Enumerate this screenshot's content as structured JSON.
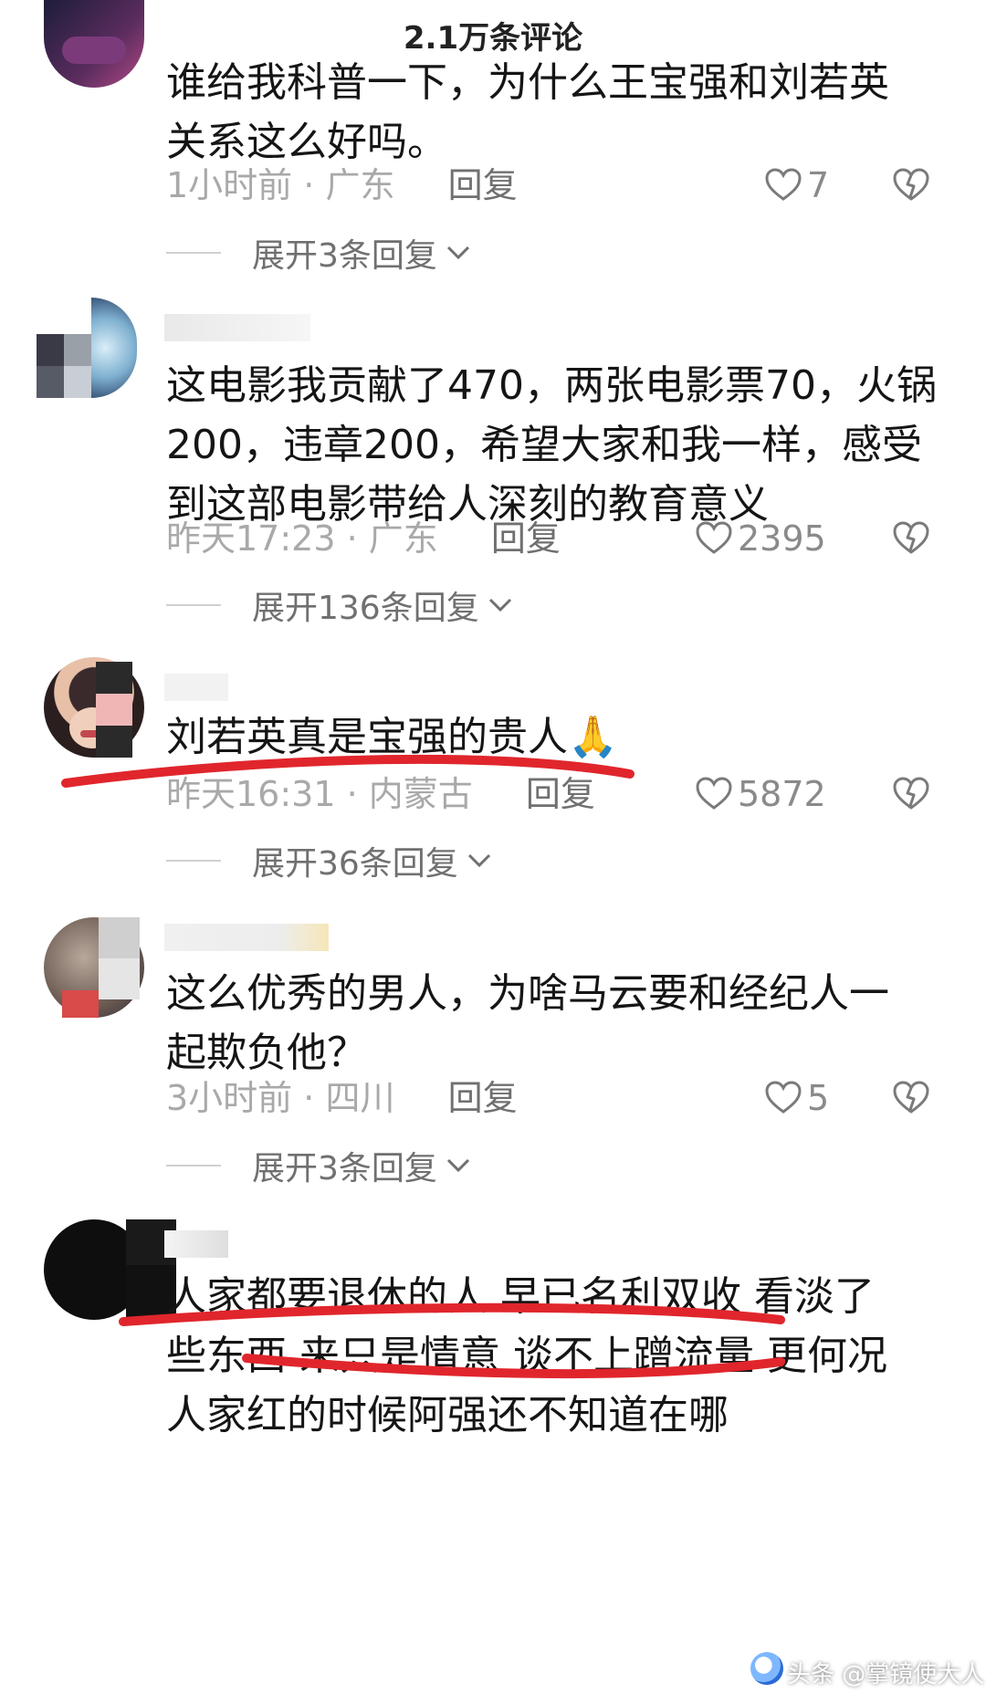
{
  "header": {
    "title": "2.1万条评论"
  },
  "comments": [
    {
      "text": "谁给我科普一下，为什么王宝强和刘若英\n关系这么好吗。",
      "time": "1小时前",
      "location": "广东",
      "reply_label": "回复",
      "likes": "7",
      "expand_label": "展开3条回复"
    },
    {
      "text": "这电影我贡献了470，两张电影票70，火锅\n200，违章200，希望大家和我一样，感受\n到这部电影带给人深刻的教育意义",
      "time": "昨天17:23",
      "location": "广东",
      "reply_label": "回复",
      "likes": "2395",
      "expand_label": "展开136条回复"
    },
    {
      "text": "刘若英真是宝强的贵人🙏",
      "time": "昨天16:31",
      "location": "内蒙古",
      "reply_label": "回复",
      "likes": "5872",
      "expand_label": "展开36条回复"
    },
    {
      "text": "这么优秀的男人，为啥马云要和经纪人一\n起欺负他？",
      "time": "3小时前",
      "location": "四川",
      "reply_label": "回复",
      "likes": "5",
      "expand_label": "展开3条回复"
    },
    {
      "text": "人家都要退休的人 早已名利双收 看淡了\n些东西 来只是情意 谈不上蹭流量 更何况\n人家红的时候阿强还不知道在哪",
      "time": "",
      "location": "",
      "reply_label": "",
      "likes": "",
      "expand_label": ""
    }
  ],
  "watermark": "头条 @掌镜使大人",
  "colors": {
    "annotation_red": "#e0262c",
    "meta_gray": "#a9a9a9",
    "text": "#151515"
  },
  "icons": [
    "back-arrow-icon",
    "heart-icon",
    "dislike-heart-icon",
    "chevron-down-icon"
  ]
}
